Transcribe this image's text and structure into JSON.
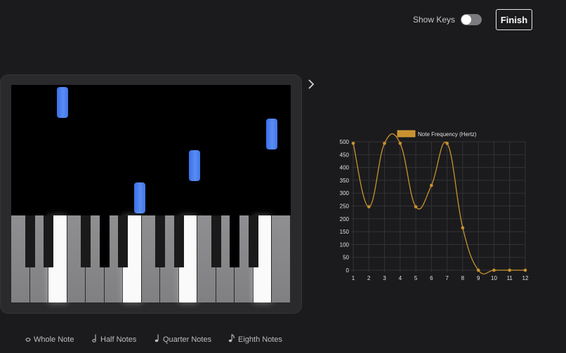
{
  "header": {
    "show_keys_label": "Show Keys",
    "show_keys_on": false,
    "finish_label": "Finish"
  },
  "nav": {
    "next_icon": "chevron-right-icon"
  },
  "legend": [
    {
      "label": "Whole Note",
      "icon": "whole-note-icon"
    },
    {
      "label": "Half Notes",
      "icon": "half-note-icon"
    },
    {
      "label": "Quarter Notes",
      "icon": "quarter-note-icon"
    },
    {
      "label": "Eighth Notes",
      "icon": "eighth-note-icon"
    }
  ],
  "colors": {
    "accent": "#c8922e",
    "note_blue": "#4a7ff0",
    "background": "#1b1b1d"
  },
  "chart_data": {
    "type": "line",
    "x": [
      1,
      2,
      3,
      4,
      5,
      6,
      7,
      8,
      9,
      10,
      11,
      12
    ],
    "series": [
      {
        "name": "Note Frequency (Hertz)",
        "values": [
          494,
          247,
          494,
          494,
          247,
          330,
          494,
          165,
          0,
          0,
          0,
          0
        ]
      }
    ],
    "ylim": [
      0,
      500
    ],
    "yticks": [
      0,
      50,
      100,
      150,
      200,
      250,
      300,
      350,
      400,
      450,
      500
    ],
    "grid": true,
    "legend_position": "top"
  }
}
